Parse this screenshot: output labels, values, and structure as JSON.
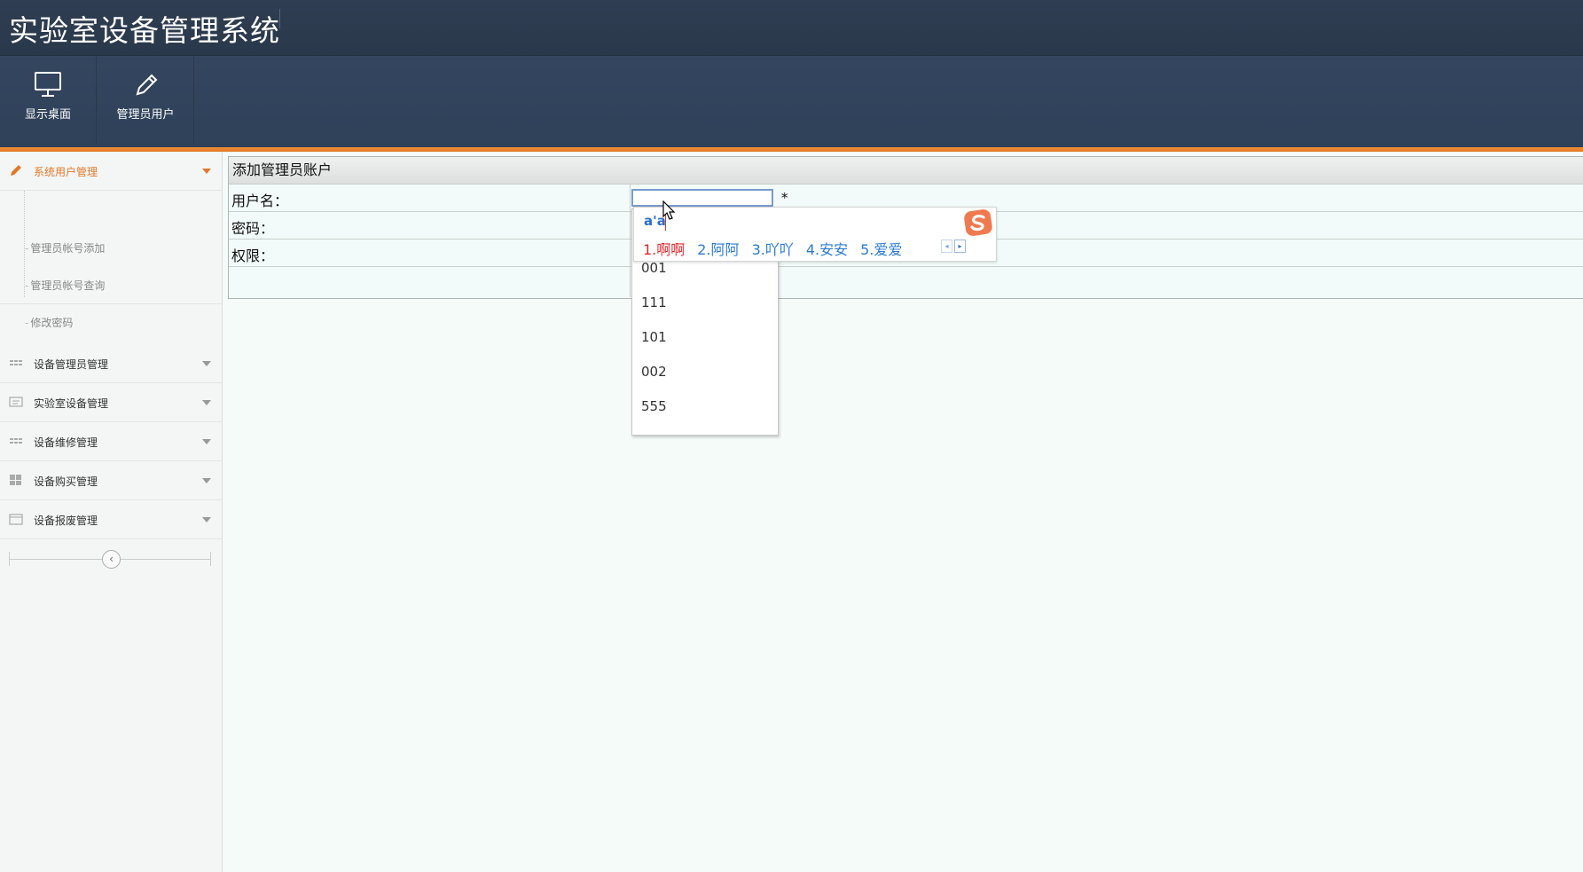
{
  "app": {
    "title": "实验室设备管理系统"
  },
  "toolbar": {
    "buttons": [
      {
        "label": "显示桌面",
        "icon": "monitor-icon"
      },
      {
        "label": "管理员用户",
        "icon": "pencil-icon"
      }
    ]
  },
  "sidebar": {
    "groups": [
      {
        "label": "系统用户管理",
        "icon": "pencil-icon",
        "active": true,
        "items": [
          "管理员帐号添加",
          "管理员帐号查询",
          "修改密码"
        ]
      },
      {
        "label": "设备管理员管理",
        "icon": "grid-icon"
      },
      {
        "label": "实验室设备管理",
        "icon": "device-icon"
      },
      {
        "label": "设备维修管理",
        "icon": "grid-icon"
      },
      {
        "label": "设备购买管理",
        "icon": "tiles-icon"
      },
      {
        "label": "设备报废管理",
        "icon": "calendar-icon"
      }
    ],
    "collapse_symbol": "‹"
  },
  "form": {
    "title": "添加管理员账户",
    "fields": [
      {
        "label": "用户名：",
        "value": ""
      },
      {
        "label": "密码："
      },
      {
        "label": "权限："
      }
    ],
    "required_mark": "*"
  },
  "autocomplete": {
    "options": [
      "001",
      "111",
      "101",
      "002",
      "555"
    ]
  },
  "ime": {
    "composition": "a'a",
    "candidates": [
      "1.啊啊",
      "2.阿阿",
      "3.吖吖",
      "4.安安",
      "5.爱爱"
    ],
    "prev_arrow": "◂",
    "next_arrow": "▸"
  },
  "colors": {
    "accent": "#e3782a",
    "header": "#34465f",
    "ime_candidate": "#2a7bd6",
    "ime_first": "#e3272c"
  }
}
